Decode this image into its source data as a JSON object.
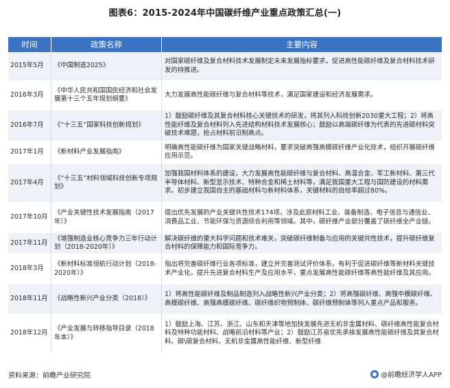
{
  "title": "图表6：2015-2024年中国碳纤维产业重点政策汇总(一)",
  "table": {
    "headers": [
      "时间",
      "政策名称",
      "主要内容"
    ],
    "rows": [
      {
        "time": "2015年5月",
        "name": "《中国制造2025》",
        "content": "对国家碳纤维及复合材料技术发展制定未来发展指标要求，促进高性能碳纤维及复合材料技术研发的持推进。"
      },
      {
        "time": "2016年3月",
        "name": "《中华人民共和国国民经济和社会发展第十三个五年规划纲要》",
        "content": "大力发展高性能碳纤维与复合材料等技术，满足国家建设和经济发展需求。"
      },
      {
        "time": "2016年7月",
        "name": "《“十三五”国家科技创新规划》",
        "content": "1）鼓励碳纤维及其复合材料核心关键技术的研发，将其列入科技创新2030重大工程；2）将高性能纤维及复合材料列入先进结构材料技术发展核心；鼓励以高端碳纤维为代表的先进碳材料突破技术难题，抢占材料前沿制高点。"
      },
      {
        "time": "2017年1月",
        "name": "《新材料产业发展指南》",
        "content": "明确高性能碳纤维为国家关键战略材料，要求突破高强高模碳纤维产业化技术，组织开展碳纤维应用示范。"
      },
      {
        "time": "2017年4月",
        "name": "《“十三五”材料领域科技创新专项规划》",
        "content": "加强我国材料体系的建设，大力发展高性能碳纤维与复合材料、高温合金、军工新材料、第三代半导体材料、新型显示技术、特种合金和稀土材料等，满足我国重大工程与国防建设的材料需求。初步建立我国自主的基础材料与新材料体系，关键材料的自给率超过80%。"
      },
      {
        "time": "2017年10月",
        "name": "《产业关键性技术发展指南（2017年）》",
        "content": "提出优先发展的产业关键共性技术174项，涉及此原材料工业、装备制造、电子信息与通信业、消费品工业、节能环保与资源综合利用等领域。其中，碳纤维产业部分覆盖了碳纤维全产业链。"
      },
      {
        "time": "2017年11月",
        "name": "《增强制造业核心竞争力三年行动计划（2018-2020年）》",
        "content": "解决碳纤维的重大科学问题和技术难关，突破碳纤维制备与应用的关键共性技术，提升碳纤维复合材料的保障能力和国际竞争力。"
      },
      {
        "time": "2018年3月",
        "name": "《新材料标准领航行动计划（2018-2020年）》",
        "content": "指出将完善碳纤维行业各项标准，建立并完善测试评价体系，有利于促进碳纤维等新材料关键技术产业化，提升先进复合材料生产及应用水平，重点发展高性能碳纤维等高性能纤维及其应用。"
      },
      {
        "time": "2018年11月",
        "name": "《战略性新兴产业分类（2018）》",
        "content": "1）将高性能碳纤维及制品制造列入战略性新兴产业分类；2）将高强碳纤维、高强中模碳纤维、高模碳纤维、高强高模碳纤维、碳纤维织物预制体、碳纤维预制体等列入重点产品和服务。"
      },
      {
        "time": "2018年12月",
        "name": "《产业发展与转移指导目录（2018年本）》",
        "content": "1）鼓励上海、江苏、浙江、山东和天津等地加快发展先进无机非金属材料、碳纤维高性能复合材料及特种功能材料、战略前沿材料等产业；2）鼓励江苏省优先承接发展高性能碳纤维及其复合材料、碳\\碳复合材料、无机非金属高性能纤维、新型纤维"
      }
    ]
  },
  "source": "资料来源：前瞻产业研究院",
  "brand": "@前瞻经济学人APP",
  "watermark_text": "前瞻产业研究院",
  "colors": {
    "header_bg": "#3a72c4",
    "row_alt": "#eef1f6"
  }
}
